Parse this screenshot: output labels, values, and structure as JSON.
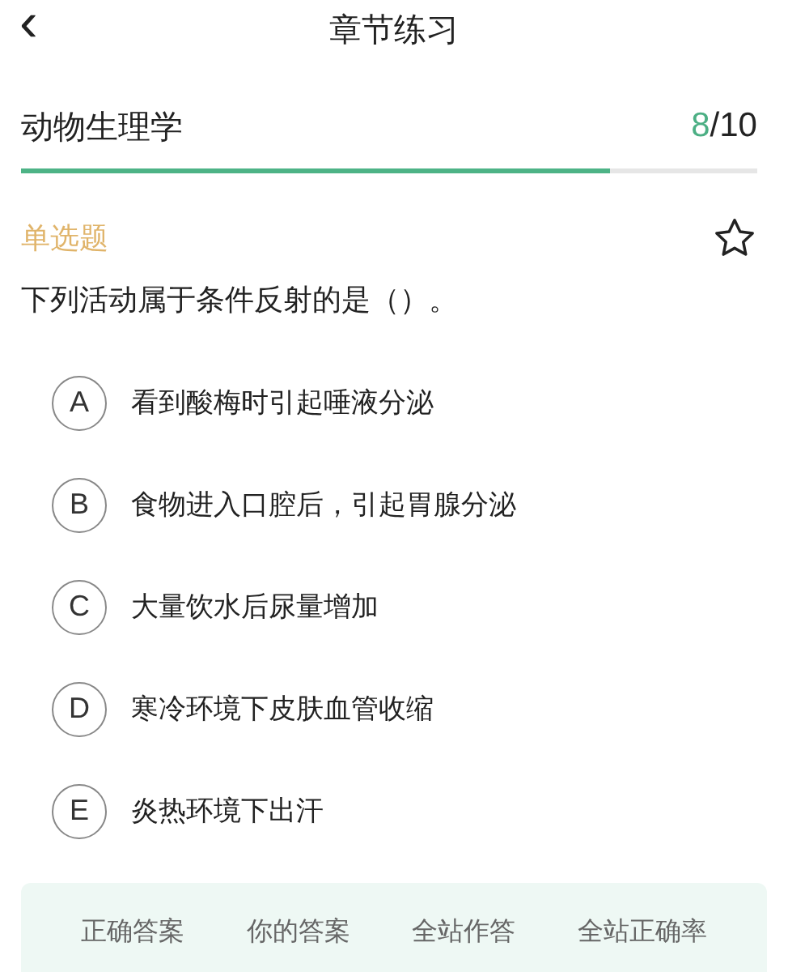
{
  "header": {
    "back_icon": "‹",
    "title": "章节练习"
  },
  "progress": {
    "subject": "动物生理学",
    "current": "8",
    "total": "/10",
    "level": 0.8
  },
  "question": {
    "type": "单选题",
    "favorited": false,
    "text": "下列活动属于条件反射的是（）。",
    "options": [
      {
        "letter": "A",
        "text": "看到酸梅时引起唾液分泌",
        "selected": false
      },
      {
        "letter": "B",
        "text": "食物进入口腔后，引起胃腺分泌",
        "selected": false
      },
      {
        "letter": "C",
        "text": "大量饮水后尿量增加",
        "selected": false
      },
      {
        "letter": "D",
        "text": "寒冷环境下皮肤血管收缩",
        "selected": false
      },
      {
        "letter": "E",
        "text": "炎热环境下出汗",
        "selected": false
      }
    ]
  },
  "answer_panel": {
    "columns": [
      "正确答案",
      "你的答案",
      "全站作答",
      "全站正确率"
    ]
  }
}
